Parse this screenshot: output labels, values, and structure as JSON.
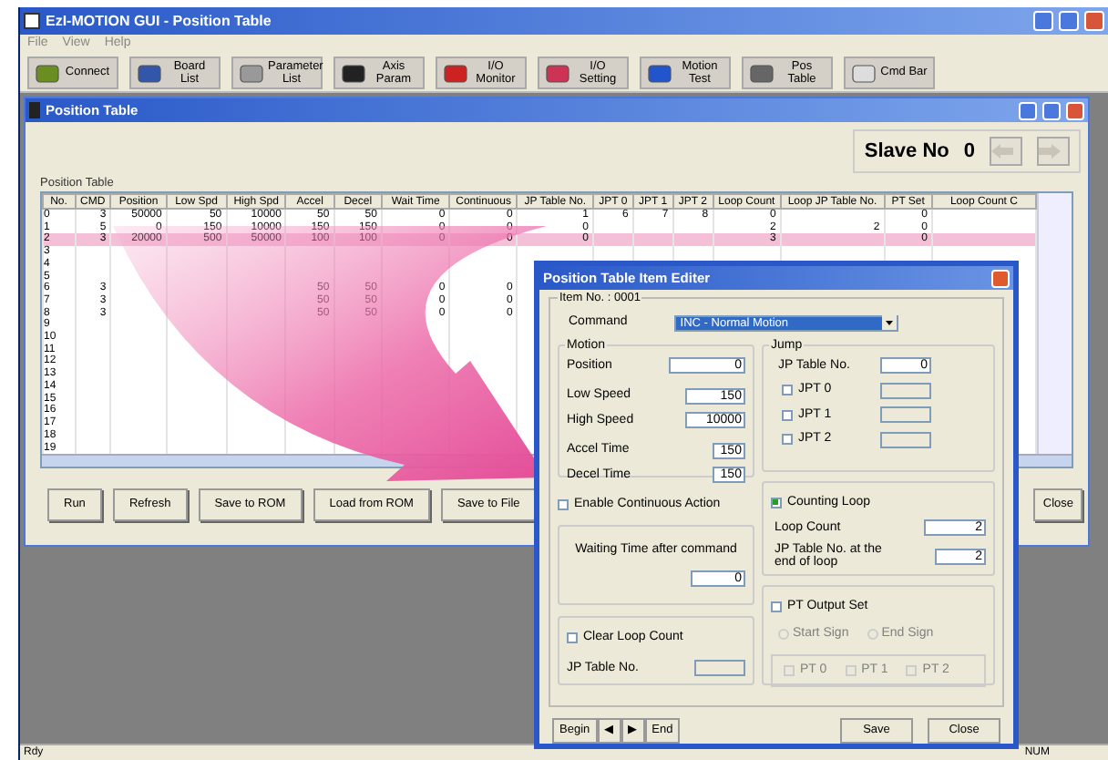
{
  "window": {
    "title": "EzI-MOTION GUI - Position Table"
  },
  "menu": [
    "File",
    "View",
    "Help"
  ],
  "toolbar": [
    {
      "label": "Connect",
      "color": "#6b8e23"
    },
    {
      "label": "Board List",
      "color": "#3355aa"
    },
    {
      "label": "Parameter List",
      "color": "#999999"
    },
    {
      "label": "Axis Param",
      "color": "#222222"
    },
    {
      "label": "I/O Monitor",
      "color": "#cc2222"
    },
    {
      "label": "I/O Setting",
      "color": "#cc3355"
    },
    {
      "label": "Motion Test",
      "color": "#2255cc"
    },
    {
      "label": "Pos Table",
      "color": "#666666"
    },
    {
      "label": "Cmd Bar",
      "color": "#dddddd"
    }
  ],
  "child_window": {
    "title": "Position Table"
  },
  "slave": {
    "label": "Slave No",
    "value": "0"
  },
  "table": {
    "title": "Position Table",
    "columns": [
      "No.",
      "CMD",
      "Position",
      "Low Spd",
      "High Spd",
      "Accel",
      "Decel",
      "Wait Time",
      "Continuous",
      "JP Table No.",
      "JPT 0",
      "JPT 1",
      "JPT 2",
      "Loop Count",
      "Loop JP Table No.",
      "PT Set",
      "Loop Count C"
    ],
    "rows": [
      {
        "selected": false,
        "cells": [
          "0",
          "3",
          "50000",
          "50",
          "10000",
          "50",
          "50",
          "0",
          "0",
          "1",
          "6",
          "7",
          "8",
          "0",
          null,
          "0",
          null
        ]
      },
      {
        "selected": false,
        "cells": [
          "1",
          "5",
          "0",
          "150",
          "10000",
          "150",
          "150",
          "0",
          "0",
          "0",
          null,
          null,
          null,
          "2",
          "2",
          "0",
          null
        ]
      },
      {
        "selected": true,
        "cells": [
          "2",
          "3",
          "20000",
          "500",
          "50000",
          "100",
          "100",
          "0",
          "0",
          "0",
          null,
          null,
          null,
          "3",
          null,
          "0",
          null
        ]
      },
      {
        "selected": false,
        "cells": [
          "3"
        ]
      },
      {
        "selected": false,
        "cells": [
          "4"
        ]
      },
      {
        "selected": false,
        "cells": [
          "5"
        ]
      },
      {
        "selected": false,
        "cells": [
          "6",
          "3",
          null,
          null,
          null,
          "50",
          "50",
          "0",
          "0"
        ]
      },
      {
        "selected": false,
        "cells": [
          "7",
          "3",
          null,
          null,
          null,
          "50",
          "50",
          "0",
          "0"
        ]
      },
      {
        "selected": false,
        "cells": [
          "8",
          "3",
          null,
          null,
          null,
          "50",
          "50",
          "0",
          "0"
        ]
      },
      {
        "selected": false,
        "cells": [
          "9"
        ]
      },
      {
        "selected": false,
        "cells": [
          "10"
        ]
      },
      {
        "selected": false,
        "cells": [
          "11"
        ]
      },
      {
        "selected": false,
        "cells": [
          "12"
        ]
      },
      {
        "selected": false,
        "cells": [
          "13"
        ]
      },
      {
        "selected": false,
        "cells": [
          "14"
        ]
      },
      {
        "selected": false,
        "cells": [
          "15"
        ]
      },
      {
        "selected": false,
        "cells": [
          "16"
        ]
      },
      {
        "selected": false,
        "cells": [
          "17"
        ]
      },
      {
        "selected": false,
        "cells": [
          "18"
        ]
      },
      {
        "selected": false,
        "cells": [
          "19"
        ]
      }
    ]
  },
  "buttons": [
    "Run",
    "Refresh",
    "Save to ROM",
    "Load from ROM",
    "Save to File",
    "Close"
  ],
  "dialog": {
    "title": "Position Table Item Editer",
    "item_no": "Item No. : 0001",
    "command": {
      "label": "Command",
      "value": "INC - Normal Motion"
    },
    "motion": {
      "title": "Motion",
      "fields": [
        {
          "label": "Position",
          "value": "0"
        },
        {
          "label": "Low Speed",
          "value": "150"
        },
        {
          "label": "High Speed",
          "value": "10000"
        },
        {
          "label": "Accel Time",
          "value": "150"
        },
        {
          "label": "Decel Time",
          "value": "150"
        }
      ],
      "continuous": {
        "label": "Enable Continuous Action",
        "checked": false
      }
    },
    "waiting": {
      "label": "Waiting Time after command",
      "value": "0"
    },
    "clear_loop": {
      "label": "Clear Loop Count",
      "checked": false,
      "field_label": "JP Table No."
    },
    "jump": {
      "title": "Jump",
      "table_no": {
        "label": "JP Table No.",
        "value": "0"
      },
      "jpts": [
        {
          "label": "JPT 0",
          "checked": false
        },
        {
          "label": "JPT 1",
          "checked": false
        },
        {
          "label": "JPT 2",
          "checked": false
        }
      ]
    },
    "counting_loop": {
      "label": "Counting Loop",
      "checked": true,
      "fields": [
        {
          "label": "Loop Count",
          "value": "2"
        },
        {
          "label": "JP Table No. at the end of loop",
          "value": "2"
        }
      ]
    },
    "pt_output": {
      "label": "PT Output Set",
      "checked": false,
      "signs": [
        {
          "label": "Start Sign",
          "selected": false
        },
        {
          "label": "End Sign",
          "selected": false
        }
      ],
      "pts": [
        {
          "label": "PT 0",
          "checked": false
        },
        {
          "label": "PT 1",
          "checked": false
        },
        {
          "label": "PT 2",
          "checked": false
        }
      ]
    },
    "nav": [
      "Begin",
      "◀",
      "▶",
      "End"
    ],
    "actions": [
      "Save",
      "Close"
    ]
  },
  "status_bar": {
    "left": "Rdy",
    "right": "NUM"
  }
}
